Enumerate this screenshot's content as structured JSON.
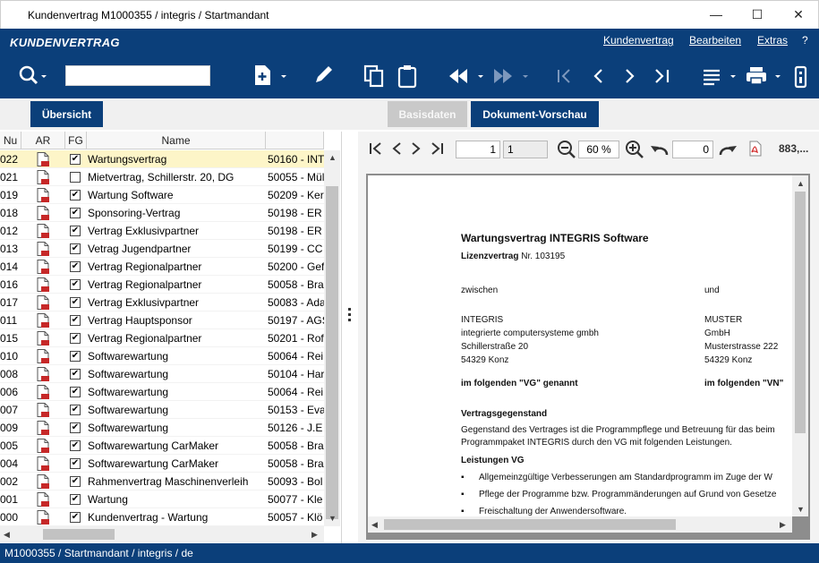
{
  "window": {
    "title": "Kundenvertrag M1000355 / integris / Startmandant",
    "minimize": "—",
    "maximize": "☐",
    "close": "✕"
  },
  "app": {
    "name": "KUNDENVERTRAG",
    "menu": {
      "kundenvertrag": "Kundenvertrag",
      "bearbeiten": "Bearbeiten",
      "extras": "Extras",
      "help": "?"
    },
    "search_value": ""
  },
  "buttons": {
    "overview": "Übersicht",
    "basisdaten": "Basisdaten",
    "preview": "Dokument-Vorschau"
  },
  "grid": {
    "columns": {
      "id": "Nu",
      "ar": "AR",
      "fg": "FG",
      "name": "Name"
    },
    "check_mark": "✔",
    "rows": [
      {
        "id": "022",
        "fg": true,
        "name": "Wartungsvertrag",
        "vn": "50160 - INT"
      },
      {
        "id": "021",
        "fg": false,
        "name": "Mietvertrag, Schillerstr. 20, DG",
        "vn": "50055 - Mül"
      },
      {
        "id": "019",
        "fg": true,
        "name": "Wartung Software",
        "vn": "50209 - Ker"
      },
      {
        "id": "018",
        "fg": true,
        "name": "Sponsoring-Vertrag",
        "vn": "50198 - ER"
      },
      {
        "id": "012",
        "fg": true,
        "name": "Vertrag Exklusivpartner",
        "vn": "50198 - ER"
      },
      {
        "id": "013",
        "fg": true,
        "name": "Vetrag Jugendpartner",
        "vn": "50199 - CC"
      },
      {
        "id": "014",
        "fg": true,
        "name": "Vertrag Regionalpartner",
        "vn": "50200 - Gef"
      },
      {
        "id": "016",
        "fg": true,
        "name": "Vertrag Regionalpartner",
        "vn": "50058 - Bra"
      },
      {
        "id": "017",
        "fg": true,
        "name": "Vertrag Exklusivpartner",
        "vn": "50083 - Ada"
      },
      {
        "id": "011",
        "fg": true,
        "name": "Vertrag Hauptsponsor",
        "vn": "50197 - AGS"
      },
      {
        "id": "015",
        "fg": true,
        "name": "Vertrag Regionalpartner",
        "vn": "50201 - Rof"
      },
      {
        "id": "010",
        "fg": true,
        "name": "Softwarewartung",
        "vn": "50064 - Rei"
      },
      {
        "id": "008",
        "fg": true,
        "name": "Softwarewartung",
        "vn": "50104 - Har"
      },
      {
        "id": "006",
        "fg": true,
        "name": "Softwarewartung",
        "vn": "50064 - Rei"
      },
      {
        "id": "007",
        "fg": true,
        "name": "Softwarewartung",
        "vn": "50153 - Eva"
      },
      {
        "id": "009",
        "fg": true,
        "name": "Softwarewartung",
        "vn": "50126 - J.E"
      },
      {
        "id": "005",
        "fg": true,
        "name": "Softwarewartung CarMaker",
        "vn": "50058 - Bra"
      },
      {
        "id": "004",
        "fg": true,
        "name": "Softwarewartung CarMaker",
        "vn": "50058 - Bra"
      },
      {
        "id": "002",
        "fg": true,
        "name": "Rahmenvertrag Maschinenverleih",
        "vn": "50093 - Bol"
      },
      {
        "id": "001",
        "fg": true,
        "name": "Wartung",
        "vn": "50077 - Kle"
      },
      {
        "id": "000",
        "fg": true,
        "name": "Kundenvertrag - Wartung",
        "vn": "50057 - Klö"
      }
    ]
  },
  "preview": {
    "page": "1",
    "page_count": "1",
    "zoom": "60 %",
    "rotation": "0",
    "size": "883,...",
    "doc": {
      "title": "Wartungsvertrag INTEGRIS Software",
      "lizenz_label": "Lizenzvertrag",
      "lizenz_nr": "Nr. 103195",
      "zwischen": "zwischen",
      "und": "und",
      "party1": [
        "INTEGRIS",
        "integrierte computersysteme gmbh",
        "Schillerstraße 20",
        "54329 Konz"
      ],
      "party2": [
        "MUSTER",
        "GmbH",
        "Musterstrasse 222",
        "54329 Konz"
      ],
      "vg": "im folgenden \"VG\" genannt",
      "vn": "im folgenden \"VN\"",
      "gegenstand_h": "Vertragsgegenstand",
      "gegenstand_1": "Gegenstand des Vertrages ist die Programmpflege und Betreuung für das beim",
      "gegenstand_2": "Programmpaket INTEGRIS durch den VG mit folgenden Leistungen.",
      "leistungen_h": "Leistungen VG",
      "bullets": [
        "Allgemeinzgültige Verbesserungen am Standardprogramm im Zuge der W",
        "Pflege der Programme bzw. Programmänderungen auf Grund von Gesetze",
        "Freischaltung der Anwendersoftware."
      ]
    }
  },
  "status": "M1000355 / Startmandant / integris / de"
}
